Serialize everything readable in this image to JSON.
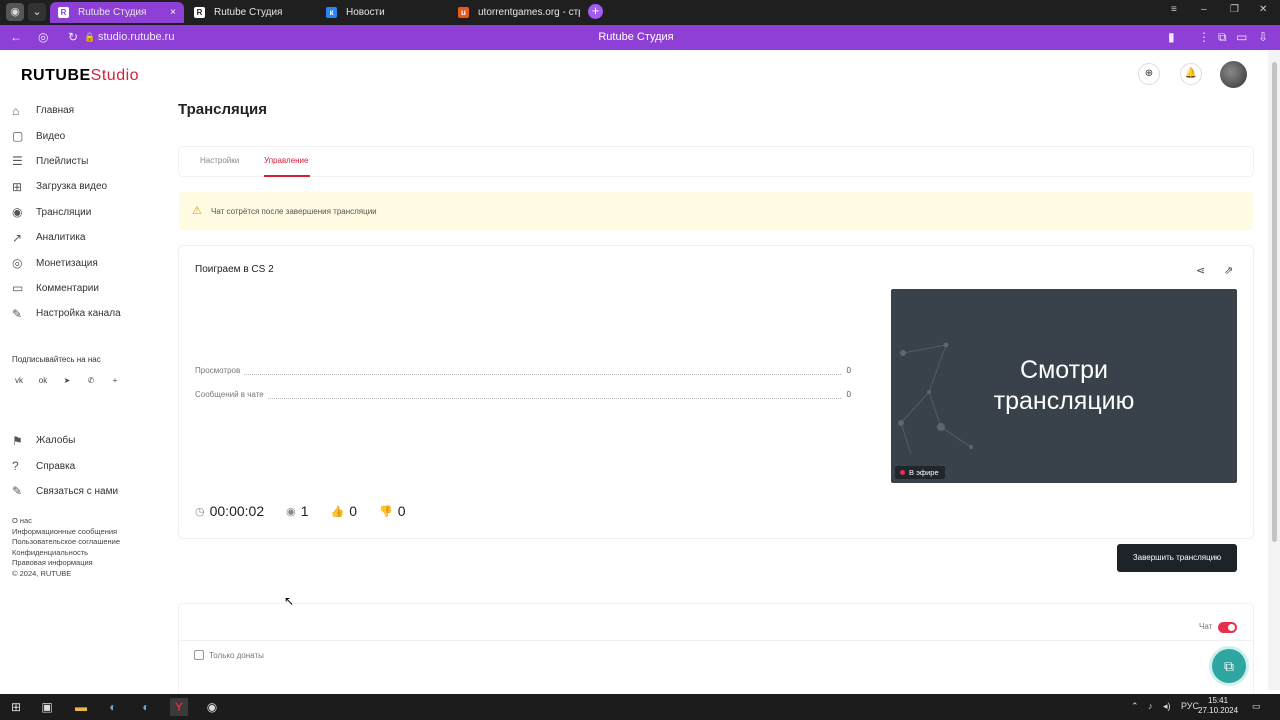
{
  "browser": {
    "tabs": [
      {
        "title": "Rutube Студия",
        "favicon": "R",
        "active": true
      },
      {
        "title": "Rutube Студия",
        "favicon": "R",
        "active": false
      },
      {
        "title": "Новости",
        "favicon": "VK",
        "active": false
      },
      {
        "title": "utorrentgames.org - стр",
        "favicon": "U",
        "active": false
      }
    ],
    "close_glyph": "×",
    "new_tab_glyph": "+",
    "url": "studio.rutube.ru",
    "page_title": "Rutube Студия",
    "accent_color": "#8e3fd6"
  },
  "logo": {
    "brand": "RUTUBE",
    "product": "Studio"
  },
  "sidebar": {
    "items": [
      {
        "label": "Главная",
        "icon": "home-icon"
      },
      {
        "label": "Видео",
        "icon": "video-icon"
      },
      {
        "label": "Плейлисты",
        "icon": "playlist-icon"
      },
      {
        "label": "Загрузка видео",
        "icon": "upload-icon"
      },
      {
        "label": "Трансляции",
        "icon": "broadcast-icon"
      },
      {
        "label": "Аналитика",
        "icon": "analytics-icon"
      },
      {
        "label": "Монетизация",
        "icon": "monetization-icon"
      },
      {
        "label": "Комментарии",
        "icon": "comments-icon"
      },
      {
        "label": "Настройка канала",
        "icon": "settings-icon"
      }
    ],
    "follow_label": "Подписывайтесь на нас",
    "socials": [
      "vk-icon",
      "ok-icon",
      "telegram-icon",
      "viber-icon",
      "more-icon"
    ],
    "secondary": [
      {
        "label": "Жалобы",
        "icon": "flag-icon"
      },
      {
        "label": "Справка",
        "icon": "help-icon"
      },
      {
        "label": "Связаться с нами",
        "icon": "contact-icon"
      }
    ],
    "footer": [
      "О нас",
      "Информационные сообщения",
      "Пользовательское соглашение",
      "Конфиденциальность",
      "Правовая информация",
      "© 2024, RUTUBE"
    ]
  },
  "header": {
    "icons": [
      "add-video-icon",
      "bell-icon"
    ]
  },
  "main": {
    "title": "Трансляция",
    "tabs": [
      {
        "label": "Настройки",
        "active": false
      },
      {
        "label": "Управление",
        "active": true
      }
    ],
    "alert": "Чат сотрётся после завершения трансляции",
    "stream": {
      "name": "Поиграем в CS 2",
      "stats": [
        {
          "label": "Просмотров",
          "value": "0"
        },
        {
          "label": "Сообщений в чате",
          "value": "0"
        }
      ],
      "preview_text_line1": "Смотри",
      "preview_text_line2": "трансляцию",
      "live_badge": "В эфире",
      "duration": "00:00:02",
      "viewers": "1",
      "likes": "0",
      "dislikes": "0",
      "end_button": "Завершить трансляцию"
    },
    "chat": {
      "label": "Чат",
      "enabled": true,
      "only_donations_label": "Только донаты",
      "only_donations_checked": false
    }
  },
  "brand_colors": {
    "red": "#d4213a",
    "dark": "#1d2329",
    "teal": "#2fa6a0"
  },
  "taskbar": {
    "lang": "РУС",
    "time": "15:41",
    "date": "27.10.2024"
  }
}
